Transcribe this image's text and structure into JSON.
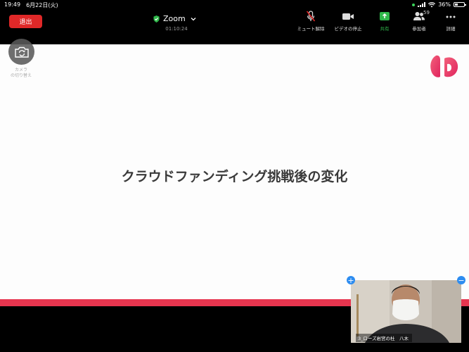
{
  "status_bar": {
    "time": "19:49",
    "date": "6月22日(火)",
    "battery_percent": "36%"
  },
  "toolbar": {
    "leave_label": "退出",
    "meeting_title": "Zoom",
    "elapsed_time": "01:10:24",
    "unmute_label": "ミュート解除",
    "stop_video_label": "ビデオの停止",
    "share_label": "共有",
    "participants_label": "参加者",
    "participants_count": "59",
    "more_label": "詳細"
  },
  "camera": {
    "switch_label_line1": "カメラ",
    "switch_label_line2": "の切り替え"
  },
  "slide": {
    "title": "クラウドファンディング挑戦後の変化"
  },
  "video": {
    "participant_name": "3_ローズ岩宮の杜　八木"
  },
  "colors": {
    "leave_red": "#e02828",
    "share_green": "#2fb84a",
    "accent_pink": "#e6354f",
    "thumb_blue": "#2d8cf0"
  },
  "icons": {
    "unmute": "microphone-muted-icon",
    "video": "video-camera-icon",
    "share": "share-screen-icon",
    "participants": "participants-icon",
    "more": "more-dots-icon",
    "switch_camera": "switch-camera-icon"
  }
}
